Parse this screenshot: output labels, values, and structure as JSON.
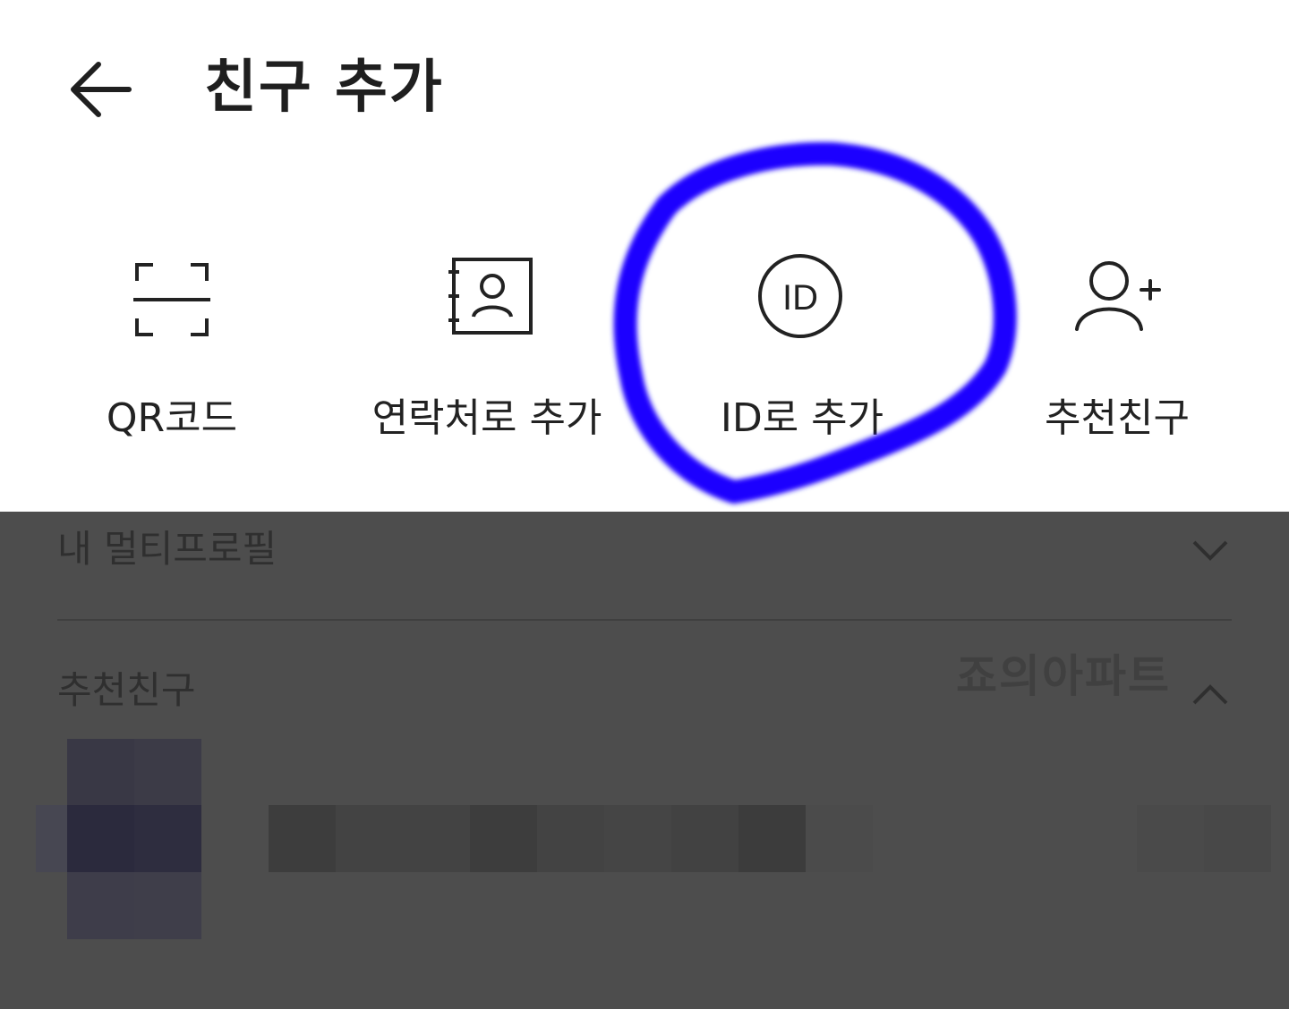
{
  "header": {
    "back_icon": "arrow-left-icon",
    "title": "친구 추가"
  },
  "actions": [
    {
      "icon": "qr-scan-icon",
      "label": "QR코드"
    },
    {
      "icon": "contact-book-icon",
      "label": "연락처로 추가"
    },
    {
      "icon": "id-circle-icon",
      "label": "ID로 추가"
    },
    {
      "icon": "person-add-icon",
      "label": "추천친구"
    }
  ],
  "sheet": {
    "multiprofile_label": "내 멀티프로필",
    "multiprofile_chevron": "chevron-down-icon",
    "recommended_label": "추천친구",
    "recommended_chevron": "chevron-up-icon",
    "watermark": "죠의아파트"
  },
  "colors": {
    "overlay": "#4d4d4d",
    "marker": "#1a00ff",
    "text": "#222222"
  }
}
